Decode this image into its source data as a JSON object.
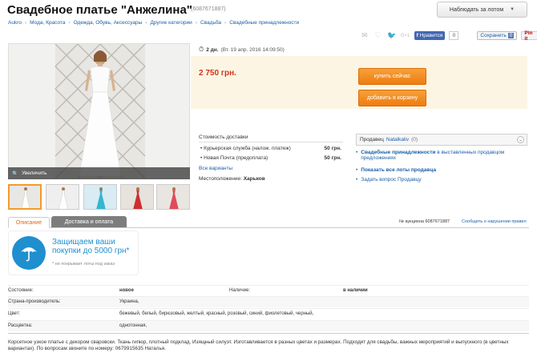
{
  "header": {
    "title": "Свадебное платье \"Анжелина\"",
    "lot_id": "(6087671887)",
    "watch_button": "Наблюдать за лотом"
  },
  "breadcrumb": [
    "Aukro",
    "Мода, Красота",
    "Одежда, Обувь, Аксессуары",
    "Другие категории",
    "Свадьба",
    "Свадебные принадлежности"
  ],
  "social": {
    "fb_like": "Нравится",
    "fb_count": "0",
    "save_label": "Сохранить",
    "save_count": "0",
    "gplus": "G+1",
    "pin": "Pin it"
  },
  "gallery": {
    "zoom_label": "Увеличить",
    "thumbnail_count": 5,
    "active_thumbnail": 1
  },
  "auction": {
    "time_left": "2 дн.",
    "end_time": "(Вт. 19 апр. 2016 14:09:50)",
    "price": "2 750 грн.",
    "buy_now": "купить сейчас",
    "add_to_cart": "добавить в корзину"
  },
  "delivery": {
    "title": "Стоимость доставки",
    "options": [
      {
        "name": "Курьерская служба (налож. платеж)",
        "price": "50 грн."
      },
      {
        "name": "Новая Почта (предоплата)",
        "price": "50 грн."
      }
    ],
    "all_variants": "Все варианты",
    "location_label": "Местоположение:",
    "location_city": "Харьков"
  },
  "seller": {
    "label": "Продавец",
    "name": "Natalkaliv",
    "rating": "(0)",
    "links": [
      {
        "bold": "Свадебные принадлежности",
        "rest": " в выставленных продавцом предложениях"
      },
      {
        "bold": "Показать все лоты продавца",
        "rest": ""
      },
      {
        "bold": "",
        "rest": "Задать вопрос Продавцу"
      }
    ]
  },
  "tabs": {
    "description": "Описание",
    "delivery_payment": "Доставка и оплата",
    "auction_number": "№ аукциона 6087671887",
    "report": "Сообщить о нарушении правил"
  },
  "protection": {
    "title": "Защищаем ваши покупки до 5000 грн*",
    "note": "* не покрывает лоты под заказ"
  },
  "attributes": [
    {
      "label": "Состояние:",
      "value": "новое",
      "label2": "Наличие:",
      "value2": "в наличии"
    },
    {
      "label": "Страна-производитель:",
      "value": "Украина,",
      "label2": "",
      "value2": ""
    },
    {
      "label": "Цвет:",
      "value": "бежевый, белый, бирюзовый, желтый, красный, розовый, синий, фиолетовый, черный,",
      "label2": "",
      "value2": ""
    },
    {
      "label": "Расцветка:",
      "value": "однотонная,",
      "label2": "",
      "value2": ""
    }
  ],
  "description": "Корсетное узкое платье с декором сваровски. Ткань гипюр, плотный подклад. Изящный силуэт. Изготавливается в разных цветах и размерах. Подходит для свадьбы, важных мероприятий и выпускного (в цветных вариантах). По вопросам звоните по номеру: 0679915635 Наталья.",
  "colors": {
    "price_red": "#d2331b",
    "button_orange": "#ee7d10",
    "link_blue": "#1a5fa8",
    "protect_blue": "#1f8fd0",
    "price_panel": "#fdf5e4"
  }
}
